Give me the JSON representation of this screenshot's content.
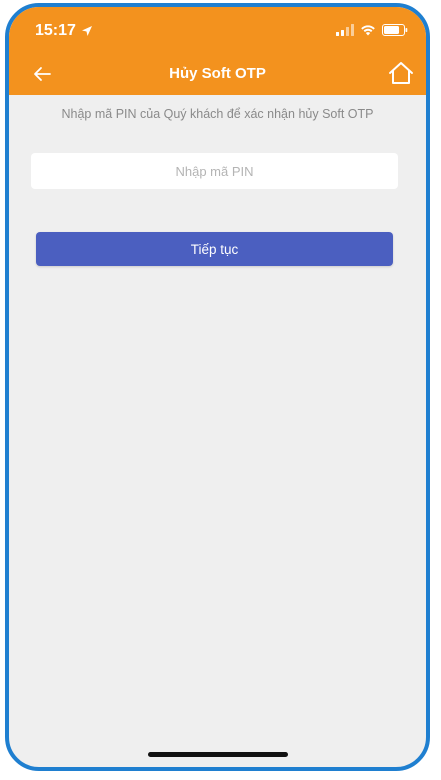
{
  "status_bar": {
    "time": "15:17"
  },
  "header": {
    "title": "Hủy Soft OTP"
  },
  "main": {
    "instruction": "Nhập mã PIN của Quý khách để xác nhận hủy Soft OTP",
    "pin_input": {
      "value": "",
      "placeholder": "Nhập mã PIN"
    },
    "continue_label": "Tiếp tục"
  },
  "icons": {
    "back": "arrow-left-icon",
    "home": "home-icon",
    "location": "location-arrow-icon",
    "signal": "signal-icon",
    "wifi": "wifi-icon",
    "battery": "battery-icon"
  },
  "colors": {
    "header_bg": "#f3921e",
    "page_bg": "#efefef",
    "button_bg": "#4b5fc0",
    "frame_border": "#1f7fd0"
  }
}
